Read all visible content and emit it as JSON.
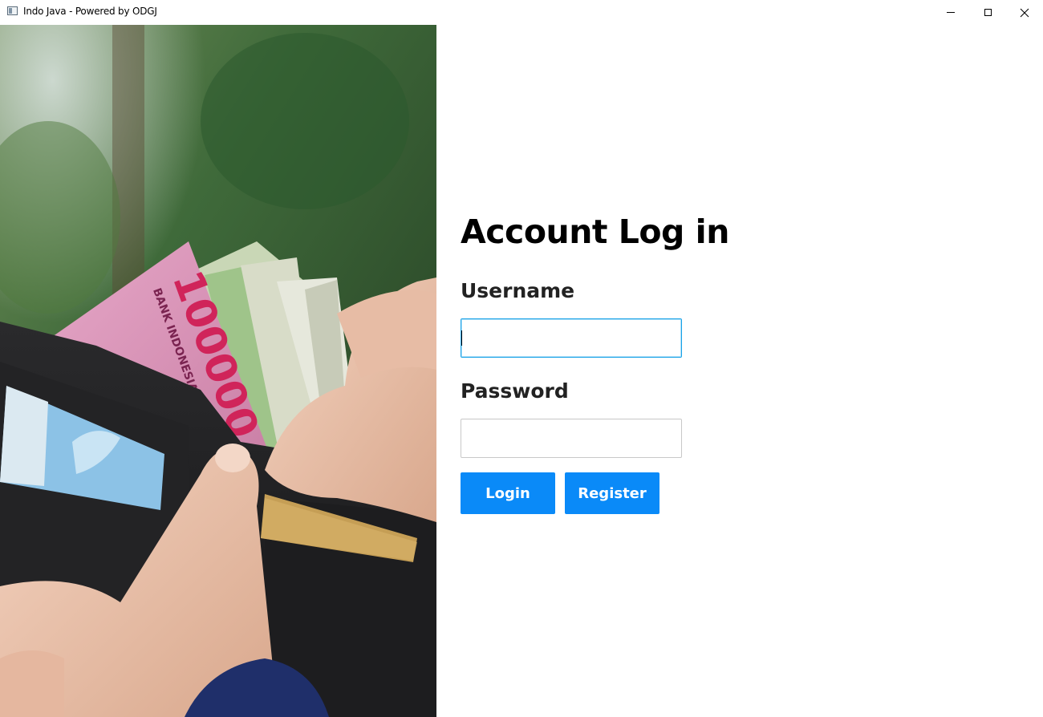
{
  "window": {
    "title": "Indo Java - Powered by ODGJ",
    "controls": [
      "minimize",
      "maximize",
      "close"
    ]
  },
  "hero_image": {
    "description_icon": "photo-wallet-banknotes",
    "banknote_text": [
      "100000",
      "BANK INDONESIA"
    ]
  },
  "form": {
    "heading": "Account Log in",
    "username_label": "Username",
    "username_value": "",
    "password_label": "Password",
    "password_value": "",
    "login_button": "Login",
    "register_button": "Register"
  },
  "colors": {
    "accent": "#0a8af8",
    "focus_border": "#1aa3e8"
  }
}
